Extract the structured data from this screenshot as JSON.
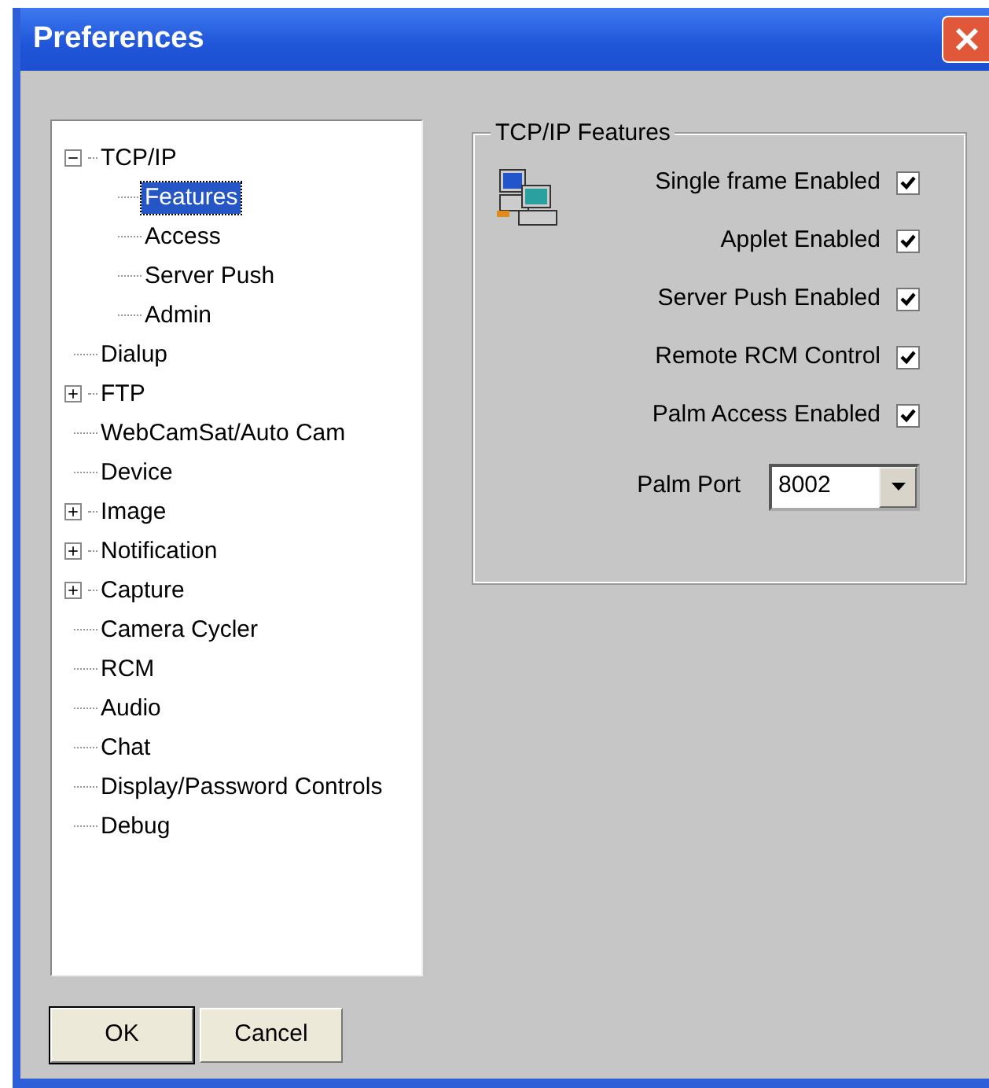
{
  "window": {
    "title": "Preferences"
  },
  "tree": [
    {
      "label": "TCP/IP",
      "kind": "group",
      "expanded": true,
      "selected": false,
      "children": [
        {
          "label": "Features",
          "kind": "leaf",
          "selected": true
        },
        {
          "label": "Access",
          "kind": "leaf",
          "selected": false
        },
        {
          "label": "Server Push",
          "kind": "leaf",
          "selected": false
        },
        {
          "label": "Admin",
          "kind": "leaf",
          "selected": false
        }
      ]
    },
    {
      "label": "Dialup",
      "kind": "leaf",
      "selected": false
    },
    {
      "label": "FTP",
      "kind": "group",
      "expanded": false,
      "selected": false
    },
    {
      "label": "WebCamSat/Auto Cam",
      "kind": "leaf",
      "selected": false
    },
    {
      "label": "Device",
      "kind": "leaf",
      "selected": false
    },
    {
      "label": "Image",
      "kind": "group",
      "expanded": false,
      "selected": false
    },
    {
      "label": "Notification",
      "kind": "group",
      "expanded": false,
      "selected": false
    },
    {
      "label": "Capture",
      "kind": "group",
      "expanded": false,
      "selected": false
    },
    {
      "label": "Camera Cycler",
      "kind": "leaf",
      "selected": false
    },
    {
      "label": "RCM",
      "kind": "leaf",
      "selected": false
    },
    {
      "label": "Audio",
      "kind": "leaf",
      "selected": false
    },
    {
      "label": "Chat",
      "kind": "leaf",
      "selected": false
    },
    {
      "label": "Display/Password Controls",
      "kind": "leaf",
      "selected": false
    },
    {
      "label": "Debug",
      "kind": "leaf",
      "selected": false
    }
  ],
  "group": {
    "title": "TCP/IP Features",
    "options": [
      {
        "label": "Single frame Enabled",
        "checked": true
      },
      {
        "label": "Applet Enabled",
        "checked": true
      },
      {
        "label": "Server Push Enabled",
        "checked": true
      },
      {
        "label": "Remote RCM Control",
        "checked": true
      },
      {
        "label": "Palm Access Enabled",
        "checked": true
      }
    ],
    "palm_port": {
      "label": "Palm Port",
      "value": "8002"
    }
  },
  "buttons": [
    {
      "label": "OK",
      "default": true
    },
    {
      "label": "Cancel",
      "default": false
    }
  ]
}
